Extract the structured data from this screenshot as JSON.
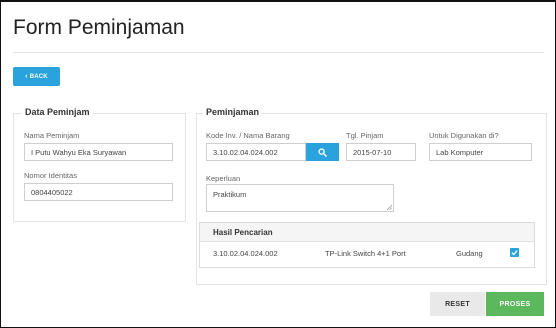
{
  "page": {
    "title": "Form Peminjaman"
  },
  "toolbar": {
    "back_label": "BACK",
    "back_icon": "chevron-left-icon"
  },
  "data_peminjam": {
    "legend": "Data Peminjam",
    "nama_label": "Nama Peminjam",
    "nama_value": "I Putu Wahyu Eka Suryawan",
    "nomor_label": "Nomor Identitas",
    "nomor_value": "0804405022"
  },
  "peminjaman": {
    "legend": "Peminjaman",
    "kode_label": "Kode Inv. / Nama Barang",
    "kode_value": "3.10.02.04.024.002",
    "search_icon": "search-icon",
    "tgl_label": "Tgl. Pinjam",
    "tgl_value": "2015-07-10",
    "untuk_label": "Untuk Digunakan di?",
    "untuk_value": "Lab Komputer",
    "keperluan_label": "Keperluan",
    "keperluan_value": "Praktikum"
  },
  "hasil": {
    "title": "Hasil Pencarian",
    "rows": [
      {
        "kode": "3.10.02.04.024.002",
        "nama": "TP-Link Switch 4+1 Port",
        "lokasi": "Gudang",
        "checked": true
      }
    ]
  },
  "actions": {
    "reset_label": "RESET",
    "proses_label": "PROSES"
  },
  "colors": {
    "accent": "#2aa3dc",
    "success": "#5cb85c",
    "neutral": "#e9e9e9"
  }
}
